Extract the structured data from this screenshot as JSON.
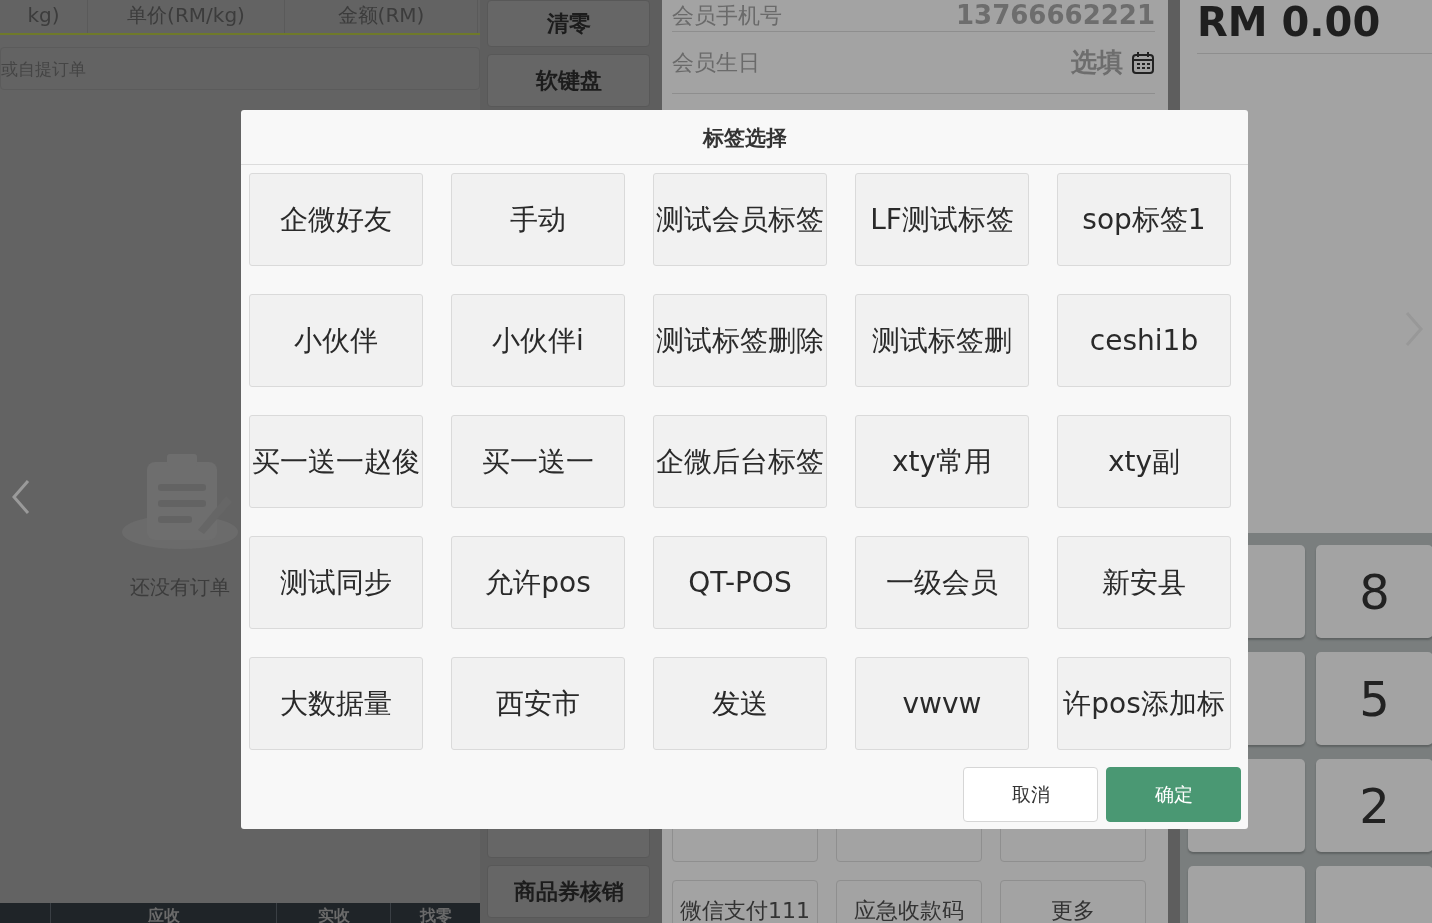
{
  "order_table": {
    "columns": [
      "kg)",
      "单价(RM/kg)",
      "金额(RM)"
    ]
  },
  "order_search": {
    "placeholder": "或自提订单"
  },
  "empty_state": {
    "message": "还没有订单"
  },
  "order_footer": {
    "columns": [
      "应收",
      "实收",
      "找零"
    ]
  },
  "function_buttons": [
    {
      "label": "清零",
      "kind": "plain"
    },
    {
      "label": "软键盘",
      "kind": "plain"
    },
    {
      "kind": "gap"
    },
    {
      "kind": "covered"
    },
    {
      "label": "商品券核销",
      "kind": "plain"
    }
  ],
  "member": {
    "fields": [
      {
        "label": "会员手机号",
        "value": "13766662221",
        "kind": "text"
      },
      {
        "label": "会员生日",
        "value": "选填",
        "kind": "date"
      }
    ]
  },
  "payment_methods": [
    {
      "kind": "covered"
    },
    {
      "kind": "covered"
    },
    {
      "kind": "covered"
    },
    {
      "label": "微信支付111",
      "kind": "label"
    },
    {
      "label": "应急收款码",
      "kind": "label"
    },
    {
      "label": "更多",
      "kind": "label"
    }
  ],
  "total": "RM 0.00",
  "keypad": [
    {
      "kind": "covered"
    },
    {
      "label": "8",
      "kind": "label"
    },
    {
      "kind": "covered"
    },
    {
      "label": "5",
      "kind": "label"
    },
    {
      "kind": "covered"
    },
    {
      "label": "2",
      "kind": "label"
    },
    {
      "kind": "covered"
    },
    {
      "kind": "covered"
    }
  ],
  "dialog": {
    "title": "标签选择",
    "tags": [
      {
        "label": "企微好友",
        "selected": false
      },
      {
        "label": "手动",
        "selected": false
      },
      {
        "label": "测试会员标签",
        "selected": false
      },
      {
        "label": "LF测试标签",
        "selected": false
      },
      {
        "label": "sop标签1",
        "selected": false
      },
      {
        "label": "小伙伴",
        "selected": false
      },
      {
        "label": "小伙伴i",
        "selected": false
      },
      {
        "label": "测试标签删除",
        "selected": false
      },
      {
        "label": "测试标签删",
        "selected": false
      },
      {
        "label": "ceshi1b",
        "selected": false
      },
      {
        "label": "买一送一赵俊",
        "selected": false
      },
      {
        "label": "买一送一",
        "selected": false
      },
      {
        "label": "企微后台标签",
        "selected": false
      },
      {
        "label": "xty常用",
        "selected": false
      },
      {
        "label": "xty副",
        "selected": false
      },
      {
        "label": "测试同步",
        "selected": false
      },
      {
        "label": "允许pos",
        "selected": false
      },
      {
        "label": "QT-POS",
        "selected": false
      },
      {
        "label": "一级会员",
        "selected": false
      },
      {
        "label": "新安县",
        "selected": false
      },
      {
        "label": "大数据量",
        "selected": false
      },
      {
        "label": "西安市",
        "selected": false
      },
      {
        "label": "发送",
        "selected": false
      },
      {
        "label": "vwvw",
        "selected": false
      },
      {
        "label": "许pos添加标",
        "selected": false
      }
    ],
    "cancel": "取消",
    "confirm": "确定"
  }
}
